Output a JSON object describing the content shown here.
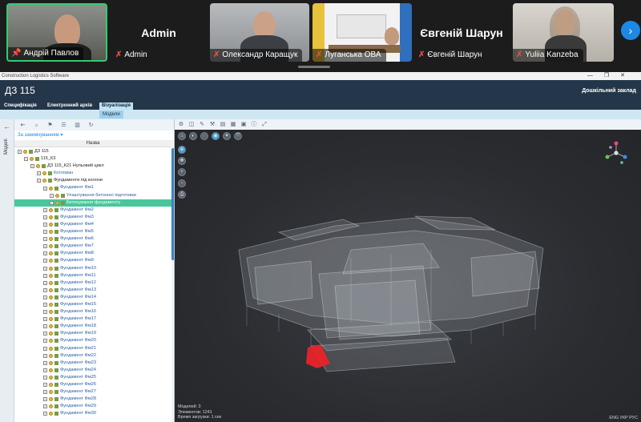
{
  "conference": {
    "participants": [
      {
        "name": "Андрій Павлов",
        "mic": "pin-icon",
        "active": true
      },
      {
        "name": "Admin",
        "mic": "mic-off",
        "display": "Admin"
      },
      {
        "name": "Олександр Каращук",
        "mic": "mic-off"
      },
      {
        "name": "Луганська ОВА",
        "mic": "mic-off"
      },
      {
        "name": "Євгеній Шарун",
        "mic": "mic-off",
        "display": "Євгеній Шарун"
      },
      {
        "name": "Yuliia Kanzeba",
        "mic": "mic-off"
      }
    ],
    "next_icon": "chevron-right-icon"
  },
  "app": {
    "window_title": "Construction Logistics Software",
    "window_controls": [
      "—",
      "❐",
      "✕"
    ],
    "doc_title": "ДЗ 115",
    "organization": "Дошкільний заклад",
    "tabs": [
      {
        "label": "Специфікація",
        "selected": false
      },
      {
        "label": "Електронний архів",
        "selected": false
      },
      {
        "label": "Візуалізація",
        "selected": true
      }
    ],
    "subtab": "Модели",
    "side_label": "Моделі",
    "tree": {
      "group_select": "За замовчуванням",
      "column_header": "Назва",
      "rows": [
        {
          "indent": 0,
          "text": "ДЗ 115",
          "kind": "root"
        },
        {
          "indent": 1,
          "text": "115_К3",
          "kind": "root"
        },
        {
          "indent": 2,
          "text": "ДЗ 115_К21 Нульовий цикл",
          "kind": "dark"
        },
        {
          "indent": 3,
          "text": "Котлован",
          "kind": "item"
        },
        {
          "indent": 3,
          "text": "Фундаменти під колони",
          "kind": "dark"
        },
        {
          "indent": 4,
          "text": "Фундамент Фм1",
          "kind": "item"
        },
        {
          "indent": 5,
          "text": "Улаштування бетонної підготовки",
          "kind": "item"
        },
        {
          "indent": 5,
          "text": "Бетонування фундаменту",
          "kind": "hl"
        },
        {
          "indent": 4,
          "text": "Фундамент Фм2",
          "kind": "item"
        },
        {
          "indent": 4,
          "text": "Фундамент Фм3",
          "kind": "item"
        },
        {
          "indent": 4,
          "text": "Фундамент Фм4",
          "kind": "item"
        },
        {
          "indent": 4,
          "text": "Фундамент Фм5",
          "kind": "item"
        },
        {
          "indent": 4,
          "text": "Фундамент Фм6",
          "kind": "item"
        },
        {
          "indent": 4,
          "text": "Фундамент Фм7",
          "kind": "item"
        },
        {
          "indent": 4,
          "text": "Фундамент Фм8",
          "kind": "item"
        },
        {
          "indent": 4,
          "text": "Фундамент Фм9",
          "kind": "item"
        },
        {
          "indent": 4,
          "text": "Фундамент Фм10",
          "kind": "item"
        },
        {
          "indent": 4,
          "text": "Фундамент Фм11",
          "kind": "item"
        },
        {
          "indent": 4,
          "text": "Фундамент Фм12",
          "kind": "item"
        },
        {
          "indent": 4,
          "text": "Фундамент Фм13",
          "kind": "item"
        },
        {
          "indent": 4,
          "text": "Фундамент Фм14",
          "kind": "item"
        },
        {
          "indent": 4,
          "text": "Фундамент Фм15",
          "kind": "item"
        },
        {
          "indent": 4,
          "text": "Фундамент Фм16",
          "kind": "item"
        },
        {
          "indent": 4,
          "text": "Фундамент Фм17",
          "kind": "item"
        },
        {
          "indent": 4,
          "text": "Фундамент Фм18",
          "kind": "item"
        },
        {
          "indent": 4,
          "text": "Фундамент Фм19",
          "kind": "item"
        },
        {
          "indent": 4,
          "text": "Фундамент Фм20",
          "kind": "item"
        },
        {
          "indent": 4,
          "text": "Фундамент Фм21",
          "kind": "item"
        },
        {
          "indent": 4,
          "text": "Фундамент Фм22",
          "kind": "item"
        },
        {
          "indent": 4,
          "text": "Фундамент Фм23",
          "kind": "item"
        },
        {
          "indent": 4,
          "text": "Фундамент Фм24",
          "kind": "item"
        },
        {
          "indent": 4,
          "text": "Фундамент Фм25",
          "kind": "item"
        },
        {
          "indent": 4,
          "text": "Фундамент Фм26",
          "kind": "item"
        },
        {
          "indent": 4,
          "text": "Фундамент Фм27",
          "kind": "item"
        },
        {
          "indent": 4,
          "text": "Фундамент Фм28",
          "kind": "item"
        },
        {
          "indent": 4,
          "text": "Фундамент Фм29",
          "kind": "item"
        },
        {
          "indent": 4,
          "text": "Фундамент Фм30",
          "kind": "item"
        }
      ]
    },
    "viewer": {
      "stats": [
        "Моделей: 3",
        "Элементов: 1241",
        "Время загрузки: 1 сек"
      ],
      "lang": "ENG  УКР  РУС",
      "highlight_color": "#e8232a"
    }
  }
}
